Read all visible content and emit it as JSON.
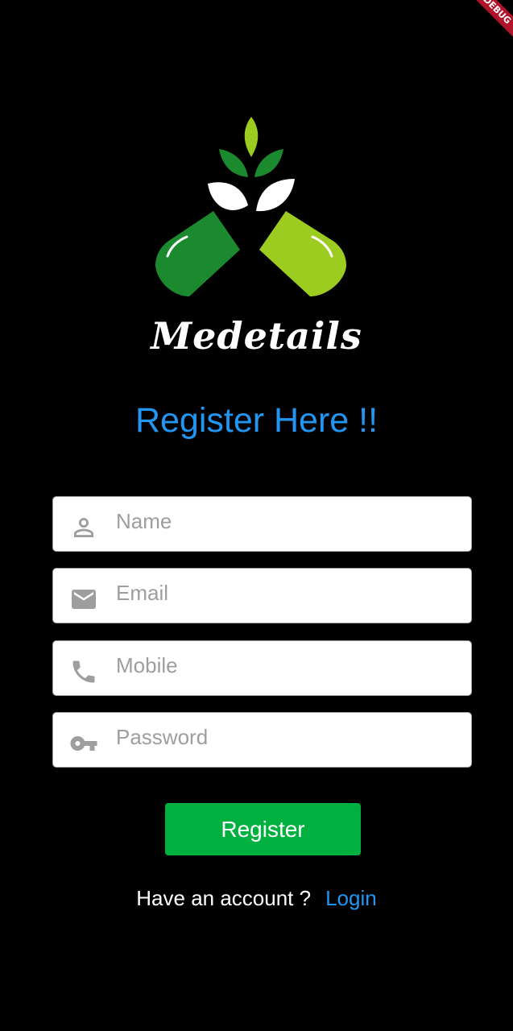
{
  "debug_banner": {
    "label": "DEBUG"
  },
  "brand": {
    "name": "Medetails"
  },
  "page": {
    "title": "Register Here !!"
  },
  "form": {
    "name": {
      "placeholder": "Name",
      "icon": "person-icon",
      "value": ""
    },
    "email": {
      "placeholder": "Email",
      "icon": "mail-icon",
      "value": ""
    },
    "mobile": {
      "placeholder": "Mobile",
      "icon": "phone-icon",
      "value": ""
    },
    "password": {
      "placeholder": "Password",
      "icon": "key-icon",
      "value": ""
    },
    "submit_label": "Register"
  },
  "footer": {
    "prompt": "Have an account ?",
    "login_label": "Login"
  },
  "colors": {
    "background": "#000000",
    "accent_blue": "#2196f3",
    "button_green": "#00b140",
    "logo_dark_green": "#1b8a2f",
    "logo_light_green": "#9ccc1f",
    "icon_grey": "#9e9e9e"
  }
}
